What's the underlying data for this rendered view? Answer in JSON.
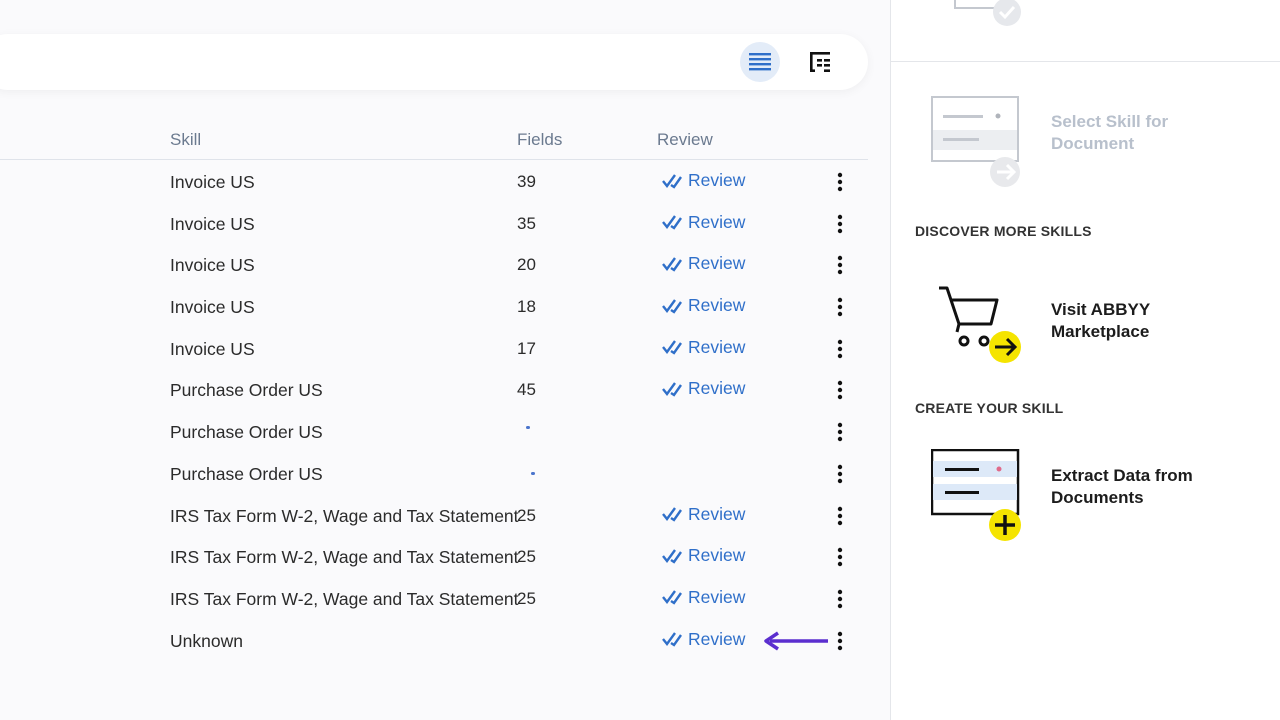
{
  "toolbar": {
    "list_view_icon": "list-view-icon",
    "tree_view_icon": "tree-view-icon"
  },
  "table": {
    "columns": {
      "skill": "Skill",
      "fields": "Fields",
      "review": "Review"
    },
    "rows": [
      {
        "skill": "Invoice US",
        "fields": "39",
        "review": "Review"
      },
      {
        "skill": "Invoice US",
        "fields": "35",
        "review": "Review"
      },
      {
        "skill": "Invoice US",
        "fields": "20",
        "review": "Review"
      },
      {
        "skill": "Invoice US",
        "fields": "18",
        "review": "Review"
      },
      {
        "skill": "Invoice US",
        "fields": "17",
        "review": "Review"
      },
      {
        "skill": "Purchase Order US",
        "fields": "45",
        "review": "Review"
      },
      {
        "skill": "Purchase Order US",
        "fields": "",
        "review": ""
      },
      {
        "skill": "Purchase Order US",
        "fields": "",
        "review": ""
      },
      {
        "skill": "IRS Tax Form W-2, Wage and Tax Statement",
        "fields": "25",
        "review": "Review"
      },
      {
        "skill": "IRS Tax Form W-2, Wage and Tax Statement",
        "fields": "25",
        "review": "Review"
      },
      {
        "skill": "IRS Tax Form W-2, Wage and Tax Statement",
        "fields": "25",
        "review": "Review"
      },
      {
        "skill": "Unknown",
        "fields": "",
        "review": "Review"
      }
    ]
  },
  "sidebar": {
    "select_skill": "Select Skill for Document",
    "discover_title": "DISCOVER MORE SKILLS",
    "marketplace": "Visit ABBYY Marketplace",
    "create_title": "CREATE YOUR SKILL",
    "extract": "Extract Data from Documents"
  },
  "colors": {
    "accent": "#2f6fc9",
    "highlight_yellow": "#f5e400",
    "arrow": "#5b2ecf",
    "disabled": "#b8c0cc"
  }
}
